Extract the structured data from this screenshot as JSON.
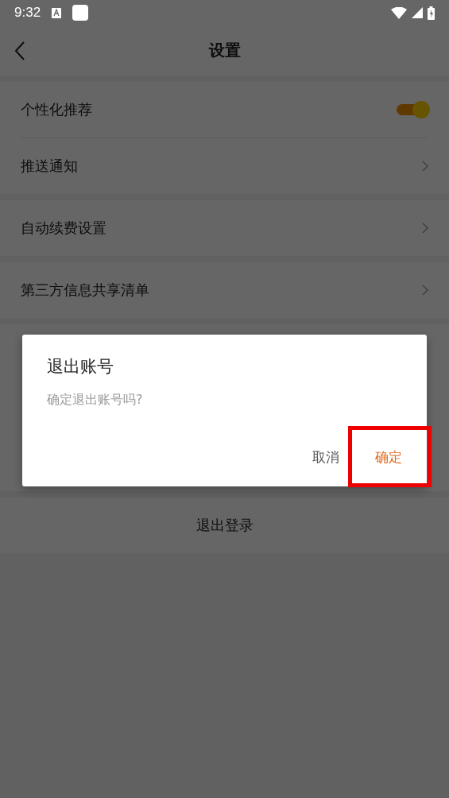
{
  "status_bar": {
    "time": "9:32"
  },
  "header": {
    "title": "设置"
  },
  "sections": [
    {
      "items": [
        {
          "label": "个性化推荐",
          "kind": "toggle",
          "on": true
        },
        {
          "label": "推送通知",
          "kind": "link"
        }
      ]
    },
    {
      "items": [
        {
          "label": "自动续费设置",
          "kind": "link"
        }
      ]
    },
    {
      "items": [
        {
          "label": "第三方信息共享清单",
          "kind": "link"
        }
      ]
    }
  ],
  "logout": {
    "label": "退出登录"
  },
  "dialog": {
    "title": "退出账号",
    "message": "确定退出账号吗?",
    "buttons": [
      {
        "label": "取消",
        "kind": "cancel",
        "highlighted": false
      },
      {
        "label": "确定",
        "kind": "confirm",
        "highlighted": true
      }
    ]
  }
}
